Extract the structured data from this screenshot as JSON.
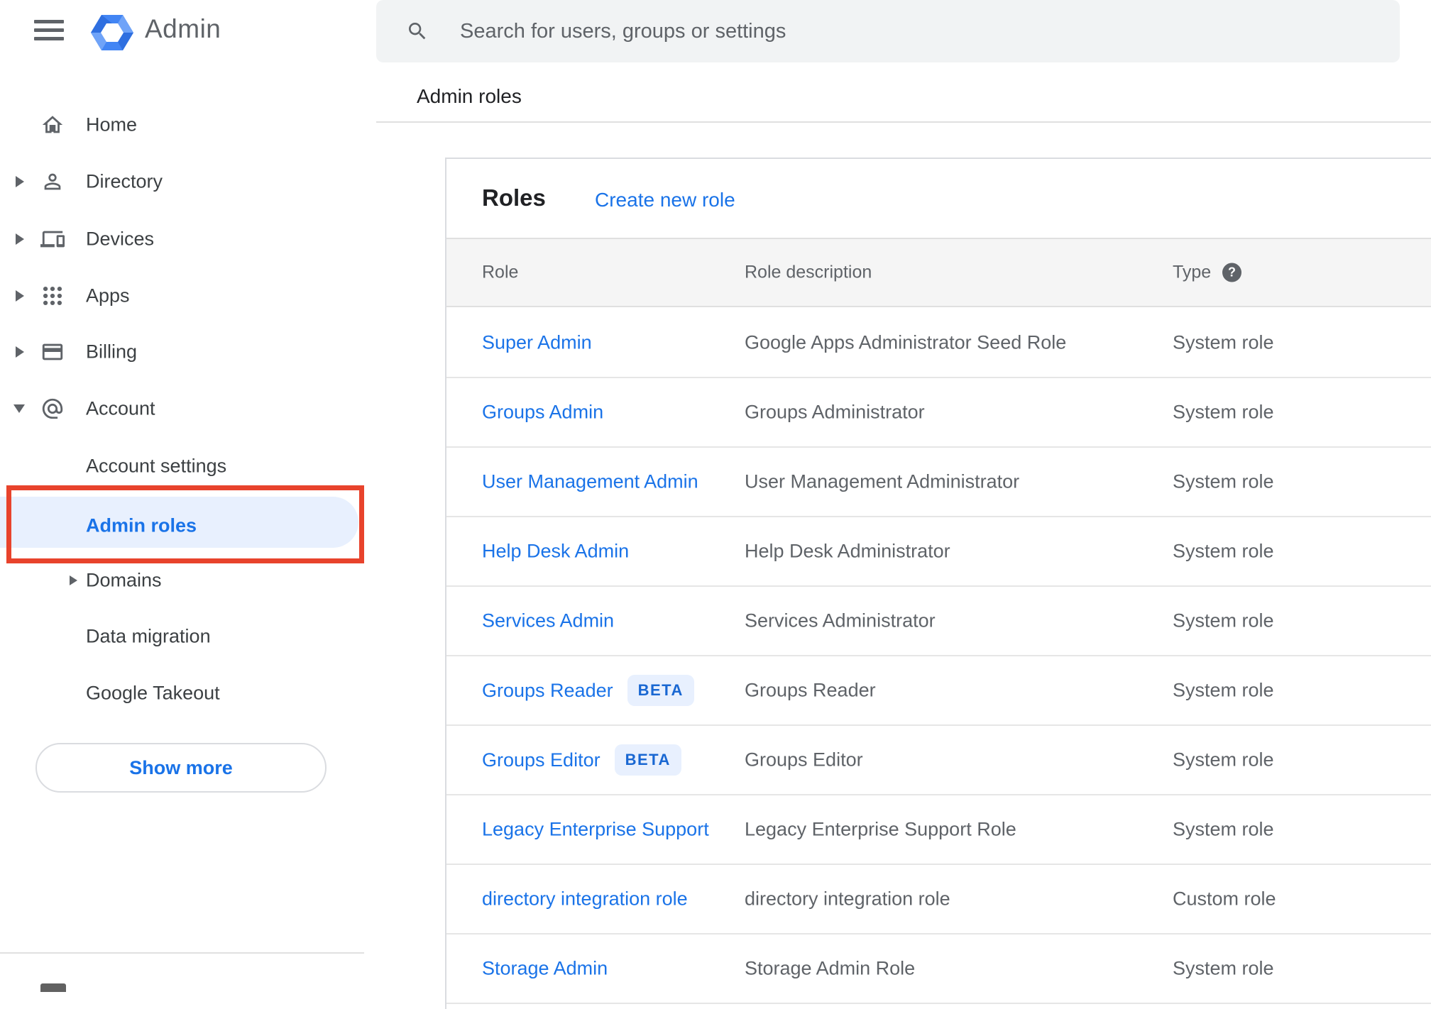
{
  "app": {
    "product_name": "Admin"
  },
  "search": {
    "placeholder": "Search for users, groups or settings"
  },
  "breadcrumb": {
    "label": "Admin roles"
  },
  "sidebar": {
    "items": [
      {
        "label": "Home"
      },
      {
        "label": "Directory"
      },
      {
        "label": "Devices"
      },
      {
        "label": "Apps"
      },
      {
        "label": "Billing"
      },
      {
        "label": "Account"
      },
      {
        "label": "Account settings"
      },
      {
        "label": "Admin roles"
      },
      {
        "label": "Domains"
      },
      {
        "label": "Data migration"
      },
      {
        "label": "Google Takeout"
      }
    ],
    "show_more_label": "Show more"
  },
  "main": {
    "card_title": "Roles",
    "create_new_role_label": "Create new role",
    "table": {
      "columns": {
        "role": "Role",
        "description": "Role description",
        "type": "Type"
      },
      "rows": [
        {
          "role": "Super Admin",
          "description": "Google Apps Administrator Seed Role",
          "type": "System role"
        },
        {
          "role": "Groups Admin",
          "description": "Groups Administrator",
          "type": "System role"
        },
        {
          "role": "User Management Admin",
          "description": "User Management Administrator",
          "type": "System role"
        },
        {
          "role": "Help Desk Admin",
          "description": "Help Desk Administrator",
          "type": "System role"
        },
        {
          "role": "Services Admin",
          "description": "Services Administrator",
          "type": "System role"
        },
        {
          "role": "Groups Reader",
          "badge": "BETA",
          "description": "Groups Reader",
          "type": "System role"
        },
        {
          "role": "Groups Editor",
          "badge": "BETA",
          "description": "Groups Editor",
          "type": "System role"
        },
        {
          "role": "Legacy Enterprise Support",
          "description": "Legacy Enterprise Support Role",
          "type": "System role"
        },
        {
          "role": "directory integration role",
          "description": "directory integration role",
          "type": "Custom role"
        },
        {
          "role": "Storage Admin",
          "description": "Storage Admin Role",
          "type": "System role"
        }
      ]
    }
  },
  "colors": {
    "accent_blue": "#1a73e8",
    "selection_background": "#e8f0fe",
    "annotation_red": "#e8432c",
    "badge_text_blue": "#1967d2",
    "icon_gray": "#5f6368"
  }
}
